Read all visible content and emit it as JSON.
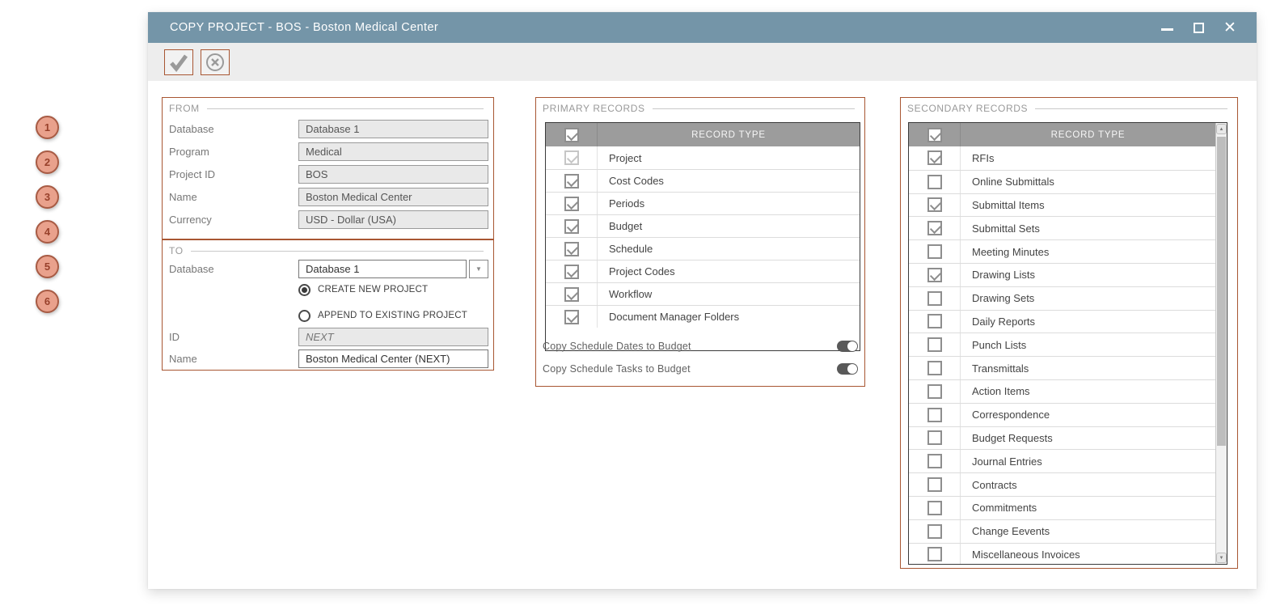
{
  "window": {
    "title": "COPY PROJECT - BOS - Boston Medical Center",
    "close_glyph": "✕"
  },
  "icons": {
    "dropdown_glyph": "▼",
    "scroll_up_glyph": "▲",
    "scroll_down_glyph": "▼"
  },
  "annotations": [
    "1",
    "2",
    "3",
    "4",
    "5",
    "6"
  ],
  "from_section": {
    "legend": "FROM",
    "fields": [
      {
        "label": "Database",
        "value": "Database 1"
      },
      {
        "label": "Program",
        "value": "Medical"
      },
      {
        "label": "Project ID",
        "value": "BOS"
      },
      {
        "label": "Name",
        "value": "Boston Medical Center"
      },
      {
        "label": "Currency",
        "value": "USD - Dollar (USA)"
      }
    ]
  },
  "to_section": {
    "legend": "TO",
    "database_label": "Database",
    "database_value": "Database 1",
    "radio_create": "CREATE NEW PROJECT",
    "radio_append": "APPEND TO EXISTING PROJECT",
    "create_selected": true,
    "id_label": "ID",
    "id_value": "NEXT",
    "name_label": "Name",
    "name_value": "Boston Medical Center (NEXT)"
  },
  "primary_records": {
    "legend": "PRIMARY RECORDS",
    "header": "RECORD TYPE",
    "header_checked": true,
    "rows": [
      {
        "label": "Project",
        "checked": true,
        "disabled": true
      },
      {
        "label": "Cost Codes",
        "checked": true
      },
      {
        "label": "Periods",
        "checked": true
      },
      {
        "label": "Budget",
        "checked": true
      },
      {
        "label": "Schedule",
        "checked": true
      },
      {
        "label": "Project Codes",
        "checked": true
      },
      {
        "label": "Workflow",
        "checked": true
      },
      {
        "label": "Document Manager Folders",
        "checked": true
      }
    ],
    "toggles": [
      {
        "label": "Copy Schedule Dates to Budget",
        "on": true
      },
      {
        "label": "Copy Schedule Tasks to Budget",
        "on": true
      }
    ]
  },
  "secondary_records": {
    "legend": "SECONDARY RECORDS",
    "header": "RECORD TYPE",
    "header_checked": true,
    "rows": [
      {
        "label": "RFIs",
        "checked": true
      },
      {
        "label": "Online Submittals",
        "checked": false
      },
      {
        "label": "Submittal Items",
        "checked": true
      },
      {
        "label": "Submittal Sets",
        "checked": true
      },
      {
        "label": "Meeting Minutes",
        "checked": false
      },
      {
        "label": "Drawing Lists",
        "checked": true
      },
      {
        "label": "Drawing Sets",
        "checked": false
      },
      {
        "label": "Daily Reports",
        "checked": false
      },
      {
        "label": "Punch Lists",
        "checked": false
      },
      {
        "label": "Transmittals",
        "checked": false
      },
      {
        "label": "Action Items",
        "checked": false
      },
      {
        "label": "Correspondence",
        "checked": false
      },
      {
        "label": "Budget Requests",
        "checked": false
      },
      {
        "label": "Journal Entries",
        "checked": false
      },
      {
        "label": "Contracts",
        "checked": false
      },
      {
        "label": "Commitments",
        "checked": false
      },
      {
        "label": "Change Eevents",
        "checked": false
      },
      {
        "label": "Miscellaneous Invoices",
        "checked": false
      }
    ]
  },
  "colors": {
    "titlebar": "#7495A8",
    "accent": "#A85632",
    "toolbar_bg": "#EDEDED",
    "table_header": "#9C9C9C",
    "toggle_on": "#595959",
    "circle_fill": "#E9A18C",
    "circle_border": "#A85B44",
    "circle_text": "#98412B"
  }
}
